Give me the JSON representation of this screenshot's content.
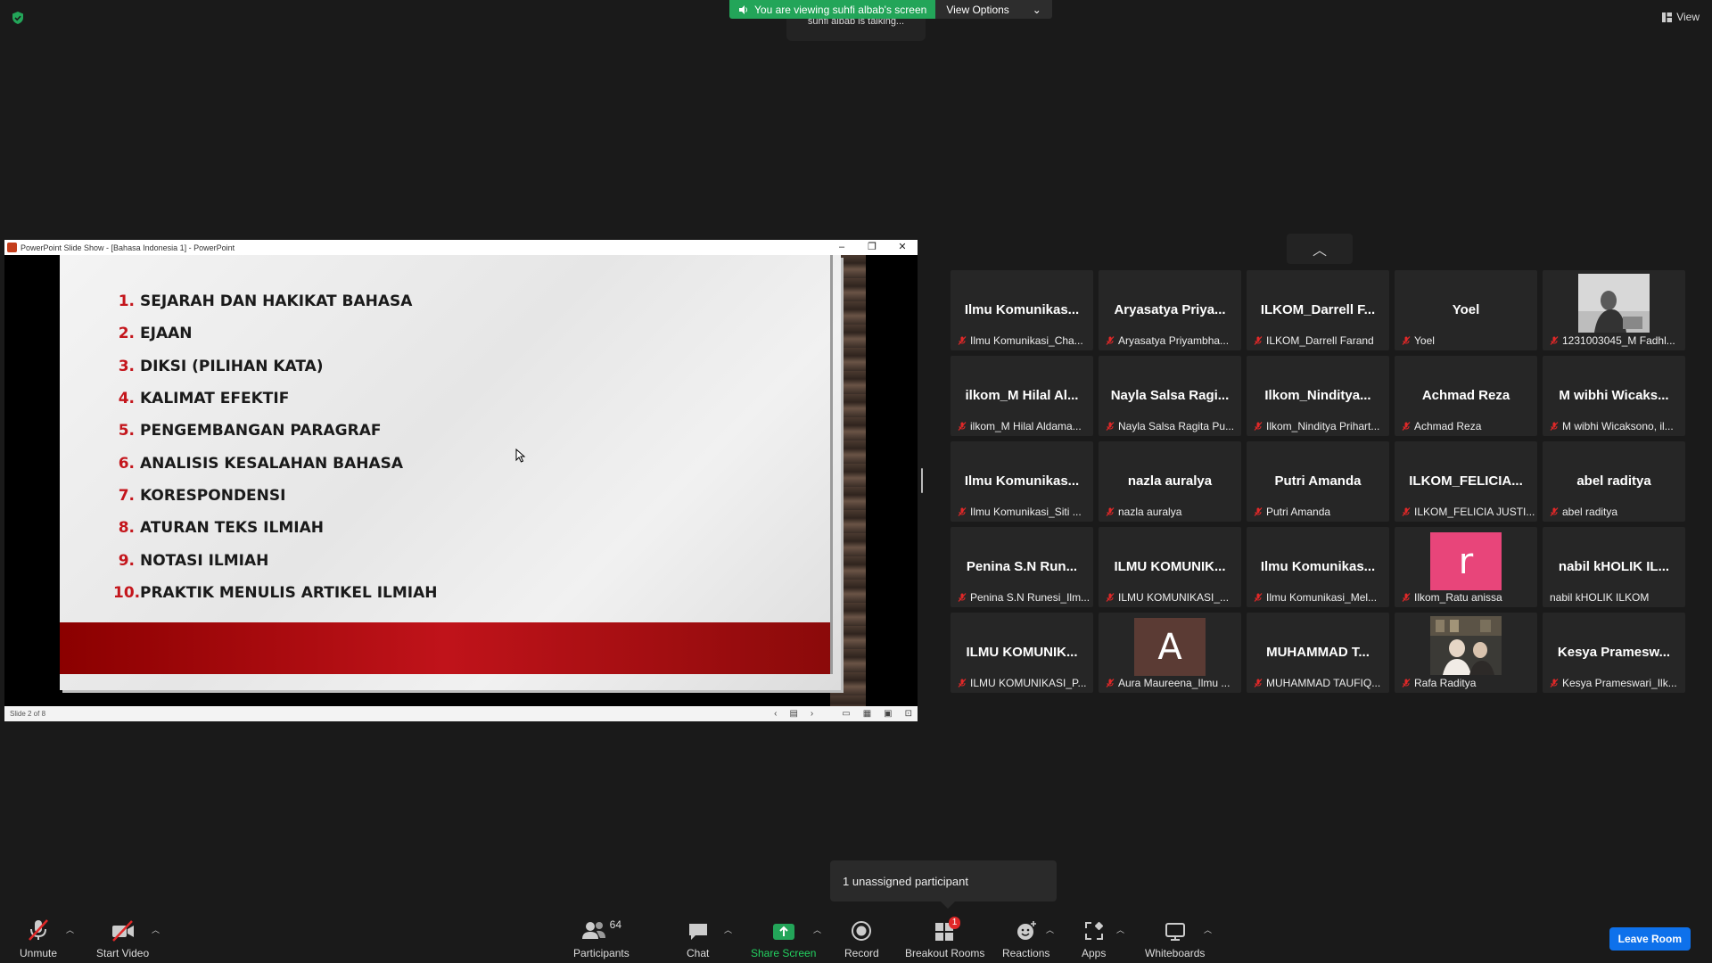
{
  "banner": {
    "viewing_text": "You are viewing suhfi albab's screen",
    "view_options": "View Options",
    "talking": "suhfi albab is talking..."
  },
  "view_button": "View",
  "ppt": {
    "title": "PowerPoint Slide Show - [Bahasa Indonesia 1] - PowerPoint",
    "status": "Slide 2 of 8",
    "items": [
      {
        "num": "1.",
        "text": "SEJARAH DAN HAKIKAT BAHASA"
      },
      {
        "num": "2.",
        "text": "EJAAN"
      },
      {
        "num": "3.",
        "text": "DIKSI (PILIHAN KATA)"
      },
      {
        "num": "4.",
        "text": "KALIMAT EFEKTIF"
      },
      {
        "num": "5.",
        "text": "PENGEMBANGAN PARAGRAF"
      },
      {
        "num": "6.",
        "text": "ANALISIS KESALAHAN BAHASA"
      },
      {
        "num": "7.",
        "text": "KORESPONDENSI"
      },
      {
        "num": "8.",
        "text": "ATURAN TEKS ILMIAH"
      },
      {
        "num": "9.",
        "text": "NOTASI ILMIAH"
      },
      {
        "num": "10.",
        "text": "PRAKTIK MENULIS ARTIKEL ILMIAH"
      }
    ]
  },
  "participants": [
    {
      "name": "Ilmu Komunikas...",
      "label": "Ilmu Komunikasi_Cha...",
      "muted": true
    },
    {
      "name": "Aryasatya Priya...",
      "label": "Aryasatya Priyambha...",
      "muted": true
    },
    {
      "name": "ILKOM_Darrell F...",
      "label": "ILKOM_Darrell Farand",
      "muted": true
    },
    {
      "name": "Yoel",
      "label": "Yoel",
      "muted": true
    },
    {
      "name": "",
      "label": "1231003045_M Fadhl...",
      "muted": true,
      "photo": "bw"
    },
    {
      "name": "ilkom_M Hilal Al...",
      "label": "ilkom_M Hilal Aldama...",
      "muted": true
    },
    {
      "name": "Nayla Salsa Ragi...",
      "label": "Nayla Salsa Ragita Pu...",
      "muted": true
    },
    {
      "name": "Ilkom_Ninditya...",
      "label": "Ilkom_Ninditya Prihart...",
      "muted": true
    },
    {
      "name": "Achmad Reza",
      "label": "Achmad Reza",
      "muted": true
    },
    {
      "name": "M wibhi Wicaks...",
      "label": "M wibhi Wicaksono, il...",
      "muted": true
    },
    {
      "name": "Ilmu Komunikas...",
      "label": "Ilmu Komunikasi_Siti ...",
      "muted": true
    },
    {
      "name": "nazla auralya",
      "label": "nazla auralya",
      "muted": true
    },
    {
      "name": "Putri Amanda",
      "label": "Putri Amanda",
      "muted": true
    },
    {
      "name": "ILKOM_FELICIA...",
      "label": "ILKOM_FELICIA JUSTI...",
      "muted": true
    },
    {
      "name": "abel raditya",
      "label": "abel raditya",
      "muted": true
    },
    {
      "name": "Penina S.N Run...",
      "label": "Penina S.N Runesi_Ilm...",
      "muted": true
    },
    {
      "name": "ILMU KOMUNIK...",
      "label": "ILMU KOMUNIKASI_...",
      "muted": true
    },
    {
      "name": "Ilmu Komunikas...",
      "label": "Ilmu Komunikasi_Mel...",
      "muted": true
    },
    {
      "name": "",
      "label": "Ilkom_Ratu anissa",
      "muted": true,
      "avatar": "r",
      "avatar_color": "#e8457a"
    },
    {
      "name": "nabil kHOLIK IL...",
      "label": "nabil kHOLIK ILKOM",
      "muted": false
    },
    {
      "name": "ILMU KOMUNIK...",
      "label": "ILMU KOMUNIKASI_P...",
      "muted": true
    },
    {
      "name": "",
      "label": "Aura Maureena_Ilmu ...",
      "muted": true,
      "avatar": "A",
      "avatar_color": "#5b3b34"
    },
    {
      "name": "MUHAMMAD T...",
      "label": "MUHAMMAD TAUFIQ...",
      "muted": true
    },
    {
      "name": "",
      "label": "Rafa Raditya",
      "muted": true,
      "photo": "color"
    },
    {
      "name": "Kesya Pramesw...",
      "label": "Kesya Prameswari_Ilk...",
      "muted": true
    }
  ],
  "tooltip": "1 unassigned participant",
  "toolbar": {
    "unmute": "Unmute",
    "start_video": "Start Video",
    "participants": "Participants",
    "participants_count": "64",
    "chat": "Chat",
    "share_screen": "Share Screen",
    "record": "Record",
    "breakout": "Breakout Rooms",
    "breakout_badge": "1",
    "reactions": "Reactions",
    "apps": "Apps",
    "whiteboards": "Whiteboards",
    "leave": "Leave Room"
  },
  "colors": {
    "share_green": "#23a559",
    "mic_red": "#e02828",
    "leave_blue": "#0e71eb",
    "slide_red": "#c4161c"
  }
}
